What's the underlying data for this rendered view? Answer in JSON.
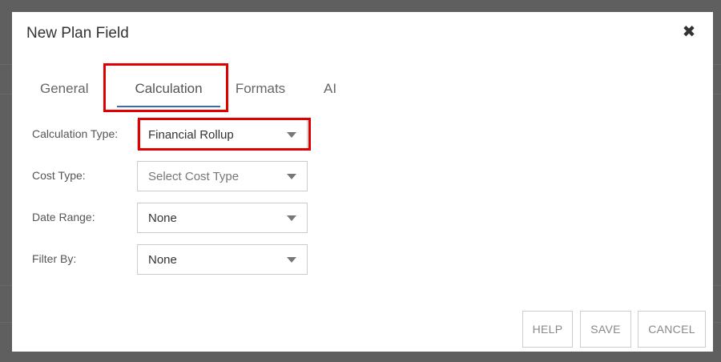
{
  "dialog": {
    "title": "New Plan Field"
  },
  "tabs": [
    {
      "label": "General",
      "active": false
    },
    {
      "label": "Calculation",
      "active": true
    },
    {
      "label": "Formats",
      "active": false
    },
    {
      "label": "AI",
      "active": false
    }
  ],
  "form": {
    "calculation_type": {
      "label": "Calculation Type:",
      "value": "Financial Rollup"
    },
    "cost_type": {
      "label": "Cost Type:",
      "placeholder": "Select Cost Type"
    },
    "date_range": {
      "label": "Date Range:",
      "value": "None"
    },
    "filter_by": {
      "label": "Filter By:",
      "value": "None"
    }
  },
  "buttons": {
    "help": "HELP",
    "save": "SAVE",
    "cancel": "CANCEL"
  },
  "colors": {
    "highlight": "#e00000",
    "active_tab_underline": "#3a6ea8",
    "overlay": "#5f5f5f"
  },
  "icons": {
    "close": "close-icon",
    "dropdown": "chevron-down-icon"
  }
}
